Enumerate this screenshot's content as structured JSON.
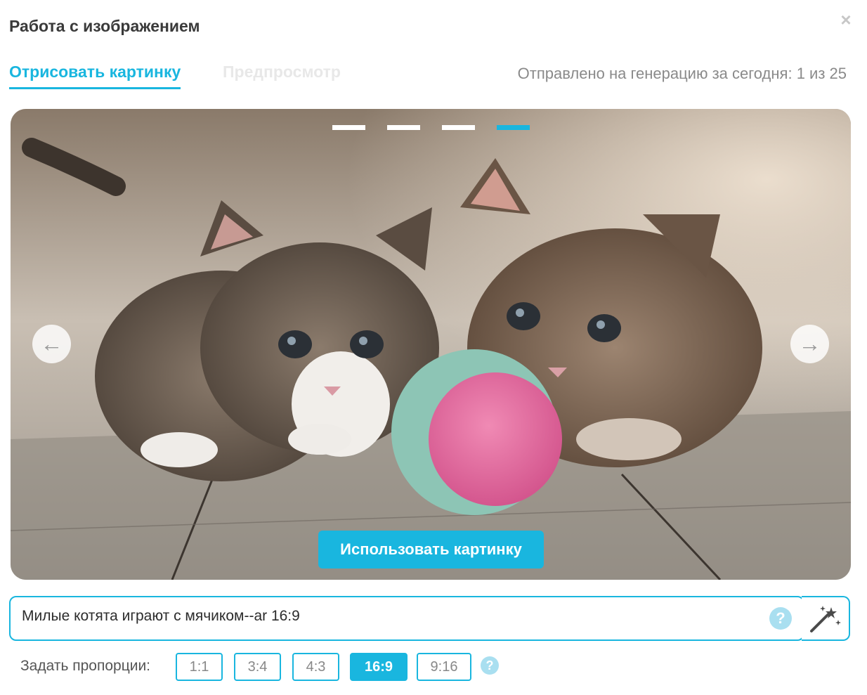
{
  "dialog": {
    "title": "Работа с изображением",
    "close_symbol": "×"
  },
  "tabs": [
    {
      "label": "Отрисовать картинку",
      "active": true
    },
    {
      "label": "Предпросмотр",
      "active": false
    }
  ],
  "quota": {
    "label": "Отправлено на генерацию за сегодня:",
    "value": "1 из 25"
  },
  "carousel": {
    "slides_total": 4,
    "active_slide": 4,
    "image_subject": "two kittens playing with a pink-and-teal ball on wooden floor",
    "prev_icon": "arrow-left-icon",
    "next_icon": "arrow-right-icon",
    "prev_symbol": "←",
    "next_symbol": "→",
    "use_button_label": "Использовать картинку"
  },
  "prompt": {
    "value": "Милые котята играют с мячиком--ar 16:9",
    "help_symbol": "?",
    "magic_icon": "magic-wand-icon"
  },
  "aspect": {
    "label": "Задать пропорции:",
    "options": [
      "1:1",
      "3:4",
      "4:3",
      "16:9",
      "9:16"
    ],
    "selected": "16:9",
    "help_symbol": "?"
  },
  "colors": {
    "accent": "#19b6df",
    "title_text": "#3a3a3a",
    "muted_text": "#9a9a9a"
  }
}
